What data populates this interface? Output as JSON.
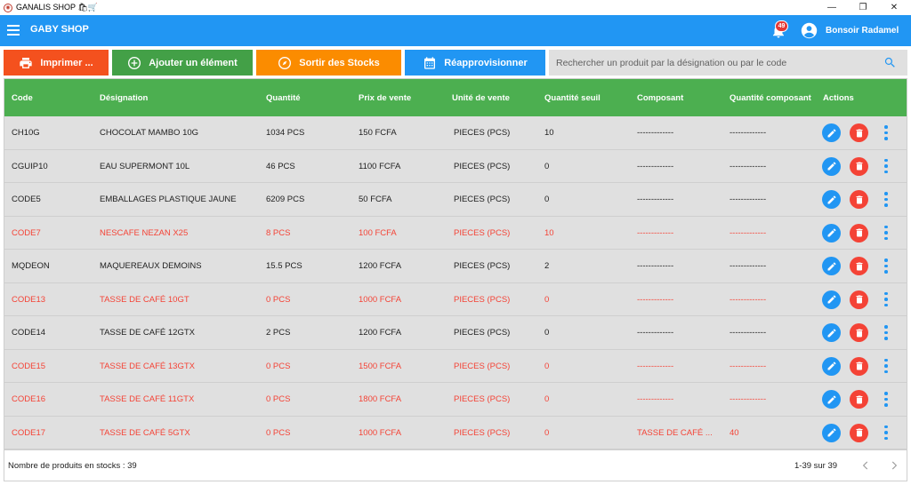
{
  "window": {
    "title": "GANALIS SHOP 🛍🛒",
    "minimize": "—",
    "restore": "❐",
    "close": "✕"
  },
  "appbar": {
    "title": "GABY SHOP",
    "notification_count": "49",
    "greeting": "Bonsoir Radamel"
  },
  "toolbar": {
    "print_label": "Imprimer ...",
    "add_label": "Ajouter un élément",
    "out_label": "Sortir des Stocks",
    "restock_label": "Réapprovisionner",
    "search_placeholder": "Rechercher un produit par la désignation ou par le code"
  },
  "colors": {
    "appbar": "#2196f3",
    "header": "#4caf50",
    "alert": "#f44336",
    "print": "#f4511e",
    "add": "#43a047",
    "out": "#fb8c00"
  },
  "table": {
    "columns": [
      "Code",
      "Désignation",
      "Quantité",
      "Prix de vente",
      "Unité de vente",
      "Quantité seuil",
      "Composant",
      "Quantité composant",
      "Actions"
    ],
    "rows": [
      {
        "code": "CH10G",
        "designation": "CHOCOLAT MAMBO 10G",
        "qty": "1034  PCS",
        "price": "150 FCFA",
        "unit": "PIECES  (PCS)",
        "threshold": "10",
        "component": "-------------",
        "comp_qty": "-------------",
        "alert": false
      },
      {
        "code": "CGUIP10",
        "designation": "EAU SUPERMONT 10L",
        "qty": "46  PCS",
        "price": "1100 FCFA",
        "unit": "PIECES  (PCS)",
        "threshold": "0",
        "component": "-------------",
        "comp_qty": "-------------",
        "alert": false
      },
      {
        "code": "CODE5",
        "designation": "EMBALLAGES PLASTIQUE JAUNE",
        "qty": "6209  PCS",
        "price": "50 FCFA",
        "unit": "PIECES  (PCS)",
        "threshold": "0",
        "component": "-------------",
        "comp_qty": "-------------",
        "alert": false
      },
      {
        "code": "CODE7",
        "designation": "NESCAFE NEZAN X25",
        "qty": "8  PCS",
        "price": "100 FCFA",
        "unit": "PIECES  (PCS)",
        "threshold": "10",
        "component": "-------------",
        "comp_qty": "-------------",
        "alert": true
      },
      {
        "code": "MQDEON",
        "designation": "MAQUEREAUX DEMOINS",
        "qty": "15.5  PCS",
        "price": "1200 FCFA",
        "unit": "PIECES  (PCS)",
        "threshold": "2",
        "component": "-------------",
        "comp_qty": "-------------",
        "alert": false
      },
      {
        "code": "CODE13",
        "designation": "TASSE DE CAFÉ 10GT",
        "qty": "0  PCS",
        "price": "1000 FCFA",
        "unit": "PIECES  (PCS)",
        "threshold": "0",
        "component": "-------------",
        "comp_qty": "-------------",
        "alert": true
      },
      {
        "code": "CODE14",
        "designation": "TASSE DE CAFÉ 12GTX",
        "qty": "2  PCS",
        "price": "1200 FCFA",
        "unit": "PIECES  (PCS)",
        "threshold": "0",
        "component": "-------------",
        "comp_qty": "-------------",
        "alert": false
      },
      {
        "code": "CODE15",
        "designation": "TASSE DE CAFÉ 13GTX",
        "qty": "0  PCS",
        "price": "1500 FCFA",
        "unit": "PIECES  (PCS)",
        "threshold": "0",
        "component": "-------------",
        "comp_qty": "-------------",
        "alert": true
      },
      {
        "code": "CODE16",
        "designation": "TASSE DE CAFÉ 11GTX",
        "qty": "0  PCS",
        "price": "1800 FCFA",
        "unit": "PIECES  (PCS)",
        "threshold": "0",
        "component": "-------------",
        "comp_qty": "-------------",
        "alert": true
      },
      {
        "code": "CODE17",
        "designation": "TASSE DE CAFÉ 5GTX",
        "qty": "0  PCS",
        "price": "1000 FCFA",
        "unit": "PIECES  (PCS)",
        "threshold": "0",
        "component": "TASSE DE CAFÉ ...",
        "comp_qty": "40",
        "alert": true
      }
    ],
    "footer_count": "Nombre de produits en stocks : 39",
    "footer_range": "1-39 sur 39"
  },
  "icons": {
    "print": "printer-icon",
    "add": "plus-circle-icon",
    "out": "compass-icon",
    "restock": "calendar-icon",
    "search": "search-icon",
    "edit": "pencil-icon",
    "delete": "trash-icon",
    "more": "more-vertical-icon"
  }
}
